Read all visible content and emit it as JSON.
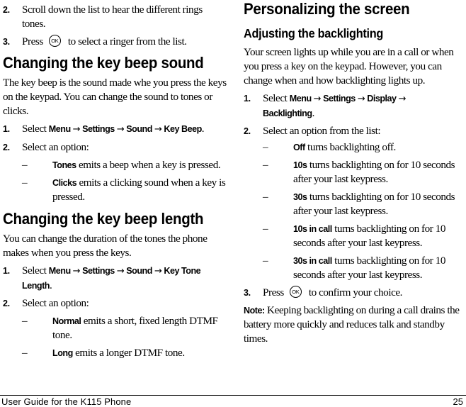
{
  "left_column": {
    "continued_steps": [
      {
        "num": "2.",
        "text": "Scroll down the list to hear the different rings tones."
      },
      {
        "num": "3.",
        "before": "Press",
        "icon": "ok-key-icon",
        "icon_label": "OK",
        "after": "to select a ringer from the list."
      }
    ],
    "section1": {
      "heading": "Changing the key beep sound",
      "intro": "The key beep is the sound made whe you press the keys on the keypad. You can change the sound to tones or clicks.",
      "step1": {
        "num": "1.",
        "prefix": "Select",
        "path": [
          "Menu",
          "Settings",
          "Sound",
          "Key Beep"
        ],
        "suffix": "."
      },
      "step2": {
        "num": "2.",
        "text": "Select an option:"
      },
      "options": [
        {
          "dash": "–",
          "term": "Tones",
          "desc": "emits a beep when a key is pressed."
        },
        {
          "dash": "–",
          "term": "Clicks",
          "desc": "emits a clicking sound when a key is pressed."
        }
      ]
    },
    "section2": {
      "heading": "Changing the key beep length",
      "intro": "You can change the duration of the tones the phone makes when you press the keys.",
      "step1": {
        "num": "1.",
        "prefix": "Select",
        "path": [
          "Menu",
          "Settings",
          "Sound",
          "Key Tone Length"
        ],
        "suffix": "."
      },
      "step2": {
        "num": "2.",
        "text": "Select an option:"
      },
      "options": [
        {
          "dash": "–",
          "term": "Normal",
          "desc": "emits a short, fixed length DTMF tone."
        },
        {
          "dash": "–",
          "term": "Long",
          "desc": "emits a longer DTMF tone."
        }
      ]
    }
  },
  "right_column": {
    "heading": "Personalizing the screen",
    "subheading": "Adjusting the backlighting",
    "intro": "Your screen lights up while you are in a call or when you press a key on the keypad. However, you can change when and how backlighting lights up.",
    "step1": {
      "num": "1.",
      "prefix": "Select",
      "path": [
        "Menu",
        "Settings",
        "Display",
        "Backlighting"
      ],
      "suffix": "."
    },
    "step2": {
      "num": "2.",
      "text": "Select an option from the list:"
    },
    "options": [
      {
        "dash": "–",
        "term": "Off",
        "desc": "turns backlighting off."
      },
      {
        "dash": "–",
        "term": "10s",
        "desc": "turns backlighting on for 10 seconds after your last keypress."
      },
      {
        "dash": "–",
        "term": "30s",
        "desc": "turns backlighting on for 10 seconds after your last keypress."
      },
      {
        "dash": "–",
        "term": "10s in call",
        "desc": "turns backlighting on for 10 seconds after your last keypress."
      },
      {
        "dash": "–",
        "term": "30s in call",
        "desc": "turns backlighting on for 10 seconds after your last keypress."
      }
    ],
    "step3": {
      "num": "3.",
      "before": "Press",
      "icon_label": "OK",
      "after": "to confirm your choice."
    },
    "note": {
      "label": "Note:",
      "text": "Keeping backlighting on during a call drains the battery more quickly and reduces talk and standby times."
    }
  },
  "footer": {
    "title": "User Guide for the K115 Phone",
    "page_number": "25"
  },
  "arrow_glyph": "→"
}
